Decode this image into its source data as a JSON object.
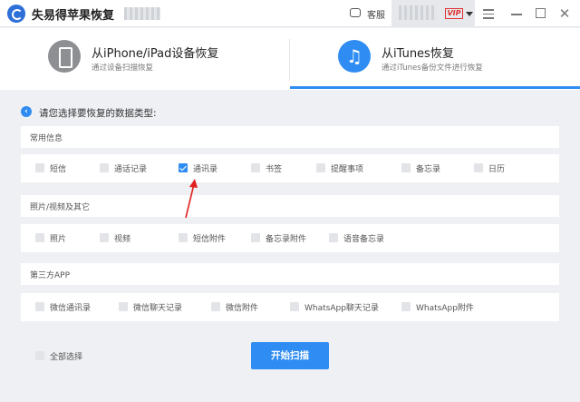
{
  "app": {
    "title": "失易得苹果恢复"
  },
  "titlebar": {
    "service_label": "客服",
    "vip_label": "VIP"
  },
  "modes": [
    {
      "title": "从iPhone/iPad设备恢复",
      "subtitle": "通过设备扫描恢复",
      "icon": "phone-icon",
      "active": false
    },
    {
      "title": "从iTunes恢复",
      "subtitle": "通过iTunes备份文件进行恢复",
      "icon": "music-note-icon",
      "active": true
    }
  ],
  "prompt": "请您选择要恢复的数据类型:",
  "categories": [
    {
      "title": "常用信息",
      "options": [
        {
          "label": "短信",
          "checked": false
        },
        {
          "label": "通话记录",
          "checked": false
        },
        {
          "label": "通讯录",
          "checked": true
        },
        {
          "label": "书签",
          "checked": false
        },
        {
          "label": "提醒事项",
          "checked": false
        },
        {
          "label": "备忘录",
          "checked": false
        },
        {
          "label": "日历",
          "checked": false
        }
      ]
    },
    {
      "title": "照片/视频及其它",
      "options": [
        {
          "label": "照片",
          "checked": false
        },
        {
          "label": "视频",
          "checked": false
        },
        {
          "label": "短信附件",
          "checked": false
        },
        {
          "label": "备忘录附件",
          "checked": false
        },
        {
          "label": "语音备忘录",
          "checked": false
        }
      ]
    },
    {
      "title": "第三方APP",
      "options": [
        {
          "label": "微信通讯录",
          "checked": false
        },
        {
          "label": "微信聊天记录",
          "checked": false
        },
        {
          "label": "微信附件",
          "checked": false
        },
        {
          "label": "WhatsApp聊天记录",
          "checked": false
        },
        {
          "label": "WhatsApp附件",
          "checked": false
        }
      ]
    }
  ],
  "footer": {
    "select_all_label": "全部选择",
    "select_all_checked": false,
    "scan_button_label": "开始扫描"
  },
  "colors": {
    "accent": "#2f8cf2",
    "vip": "#e03030",
    "annotation_arrow": "#e02020"
  }
}
